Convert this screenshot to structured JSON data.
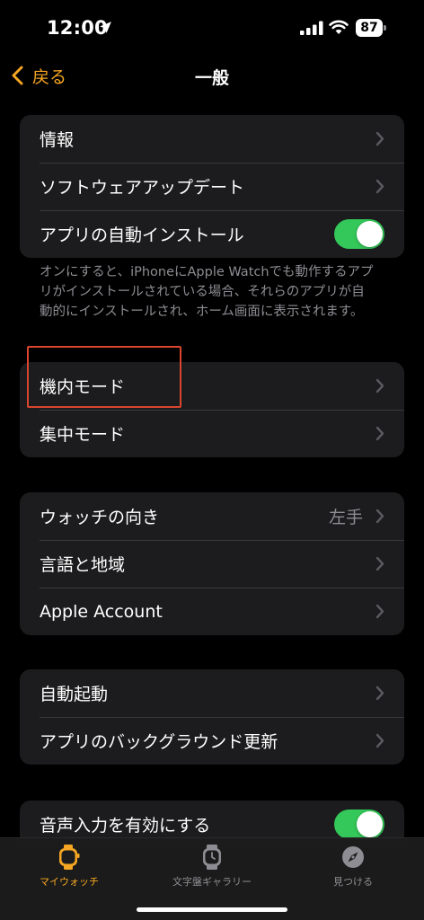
{
  "status_bar": {
    "time": "12:00",
    "battery": "87"
  },
  "nav": {
    "back_label": "戻る",
    "title": "一般"
  },
  "group1": {
    "rows": [
      {
        "label": "情報"
      },
      {
        "label": "ソフトウェアアップデート"
      },
      {
        "label": "アプリの自動インストール",
        "toggle": true
      }
    ],
    "footnote": "オンにすると、iPhoneにApple Watchでも動作するアプリがインストールされている場合、それらのアプリが自動的にインストールされ、ホーム画面に表示されます。"
  },
  "group2": {
    "rows": [
      {
        "label": "機内モード"
      },
      {
        "label": "集中モード"
      }
    ]
  },
  "group3": {
    "rows": [
      {
        "label": "ウォッチの向き",
        "value": "左手"
      },
      {
        "label": "言語と地域"
      },
      {
        "label": "Apple Account"
      }
    ]
  },
  "group4": {
    "rows": [
      {
        "label": "自動起動"
      },
      {
        "label": "アプリのバックグラウンド更新"
      }
    ]
  },
  "group5": {
    "rows": [
      {
        "label": "音声入力を有効にする",
        "toggle": true
      }
    ]
  },
  "tab_bar": {
    "tabs": [
      {
        "label": "マイウォッチ",
        "icon": "watch-icon",
        "active": true
      },
      {
        "label": "文字盤ギャラリー",
        "icon": "watch-face-icon",
        "active": false
      },
      {
        "label": "見つける",
        "icon": "compass-icon",
        "active": false
      }
    ]
  },
  "colors": {
    "accent": "#f5a623",
    "toggle_on": "#34c759",
    "highlight": "#d9452d",
    "cell_bg": "#1c1c1e"
  }
}
